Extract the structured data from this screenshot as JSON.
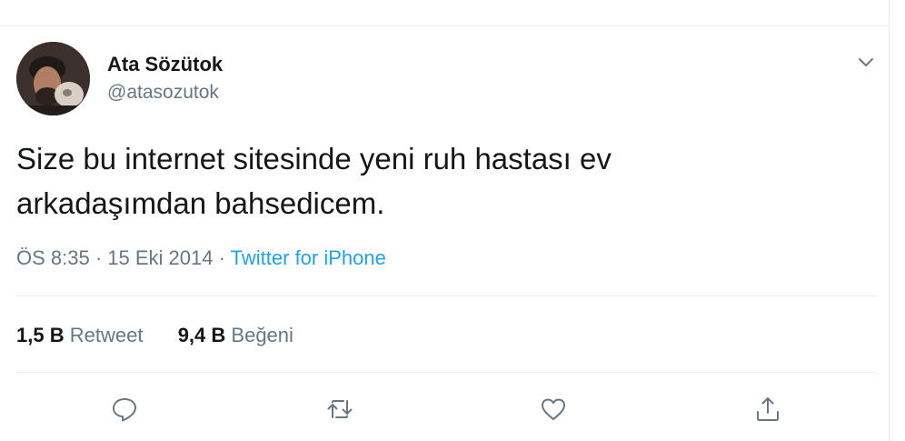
{
  "author": {
    "name": "Ata Sözütok",
    "handle": "@atasozutok"
  },
  "tweet": {
    "text_line1": "Size bu internet sitesinde yeni ruh hastası ev",
    "text_line2": "arkadaşımdan bahsedicem.",
    "time": "ÖS 8:35",
    "separator1": "·",
    "date": "15 Eki 2014",
    "separator2": "·",
    "source": "Twitter for iPhone"
  },
  "stats": {
    "retweets_count": "1,5 B",
    "retweets_label": "Retweet",
    "likes_count": "9,4 B",
    "likes_label": "Beğeni"
  },
  "icons": {
    "caret": "chevron-down-icon",
    "reply": "reply-icon",
    "retweet": "retweet-icon",
    "like": "heart-icon",
    "share": "share-icon"
  },
  "colors": {
    "text": "#14171a",
    "secondary": "#657786",
    "link": "#1da1f2",
    "border": "#e6ecf0"
  }
}
